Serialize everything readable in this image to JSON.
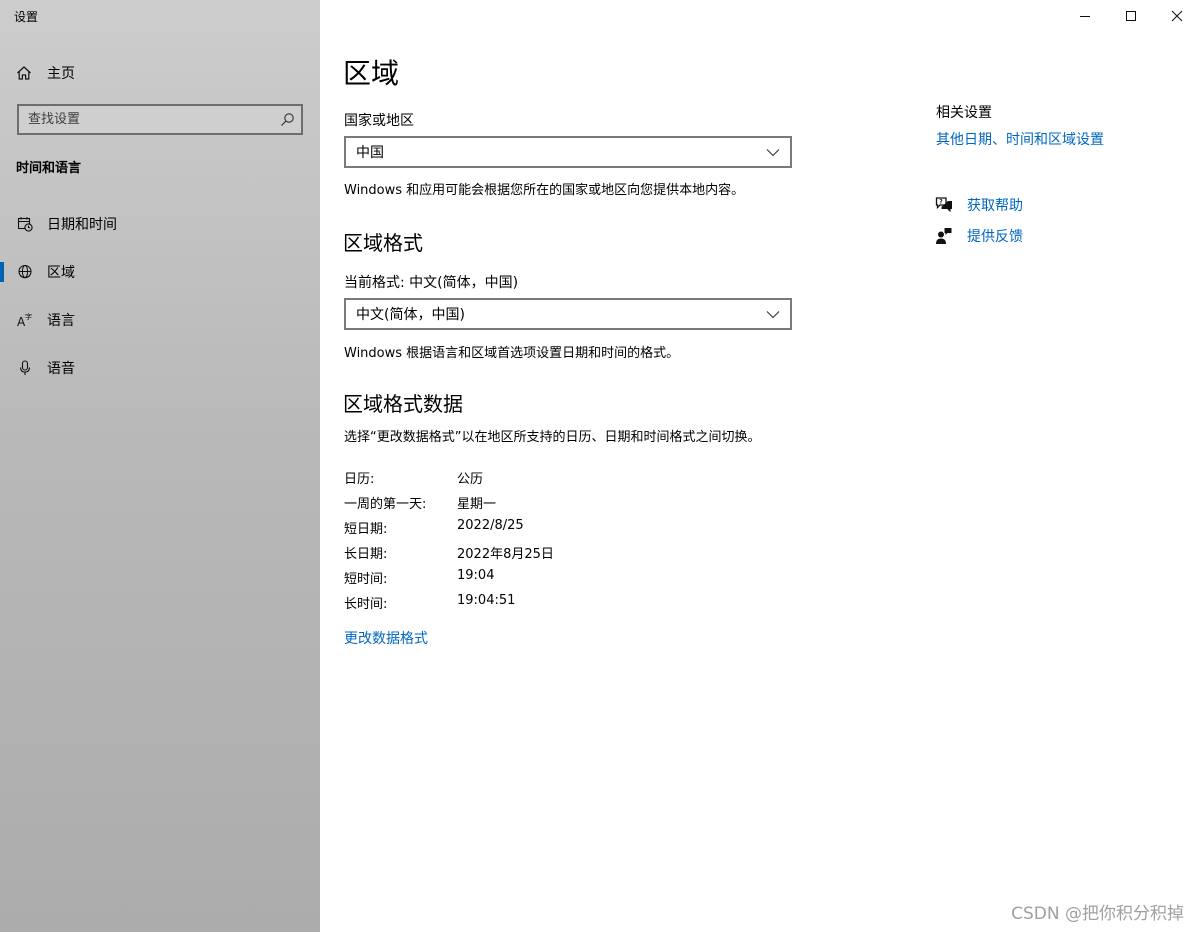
{
  "window": {
    "title": "设置"
  },
  "sidebar": {
    "home_label": "主页",
    "search_placeholder": "查找设置",
    "section_heading": "时间和语言",
    "items": [
      {
        "label": "日期和时间",
        "icon": "calendar-clock-icon",
        "active": false
      },
      {
        "label": "区域",
        "icon": "globe-icon",
        "active": true
      },
      {
        "label": "语言",
        "icon": "language-icon",
        "active": false
      },
      {
        "label": "语音",
        "icon": "microphone-icon",
        "active": false
      }
    ],
    "accent_color": "#0063b1"
  },
  "main": {
    "title": "区域",
    "country": {
      "label": "国家或地区",
      "selected": "中国",
      "description": "Windows 和应用可能会根据您所在的国家或地区向您提供本地内容。"
    },
    "regional_format": {
      "heading": "区域格式",
      "current_label": "当前格式: 中文(简体，中国)",
      "selected": "中文(简体，中国)",
      "description": "Windows 根据语言和区域首选项设置日期和时间的格式。"
    },
    "format_data": {
      "heading": "区域格式数据",
      "description": "选择“更改数据格式”以在地区所支持的日历、日期和时间格式之间切换。",
      "rows": [
        {
          "key": "日历:",
          "value": "公历"
        },
        {
          "key": "一周的第一天:",
          "value": "星期一"
        },
        {
          "key": "短日期:",
          "value": "2022/8/25"
        },
        {
          "key": "长日期:",
          "value": "2022年8月25日"
        },
        {
          "key": "短时间:",
          "value": "19:04"
        },
        {
          "key": "长时间:",
          "value": "19:04:51"
        }
      ],
      "change_link": "更改数据格式"
    }
  },
  "related": {
    "title": "相关设置",
    "link": "其他日期、时间和区域设置",
    "help_label": "获取帮助",
    "feedback_label": "提供反馈"
  },
  "watermark": "CSDN @把你积分积掉",
  "colors": {
    "link": "#0067c0",
    "sidebar_bg": "#bdbdbd"
  }
}
